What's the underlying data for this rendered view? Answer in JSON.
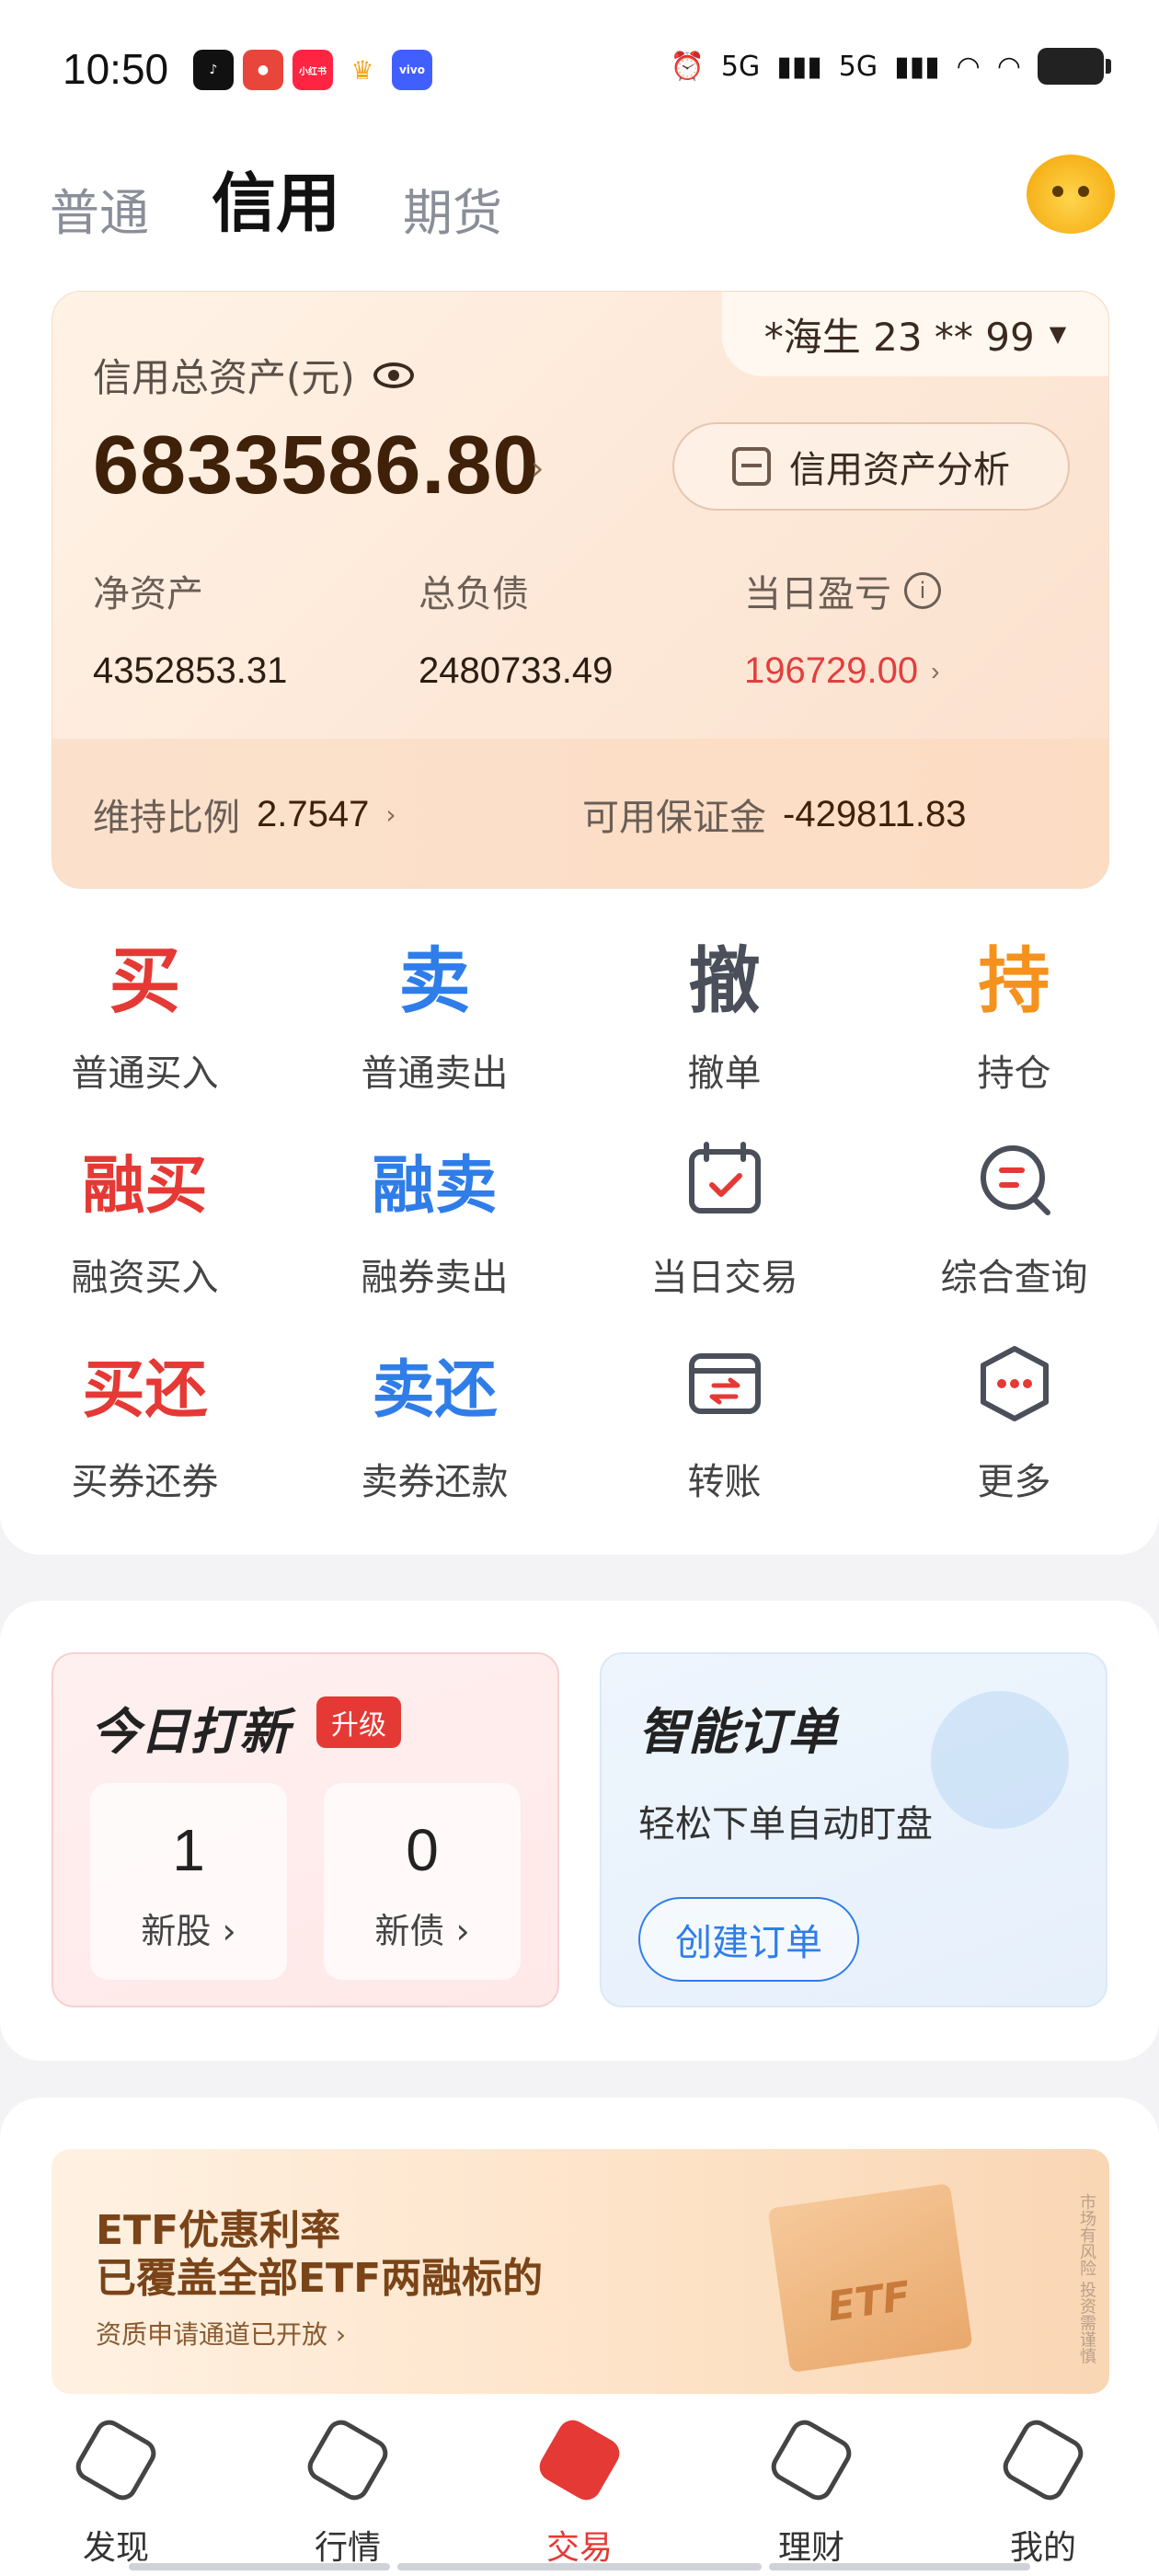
{
  "status_bar": {
    "time": "10:50",
    "app_icons": [
      {
        "name": "tiktok-icon",
        "text": "♪",
        "color": "#111111"
      },
      {
        "name": "weibo-icon",
        "text": "●",
        "color": "#e8463b"
      },
      {
        "name": "xiaohongshu-icon",
        "text": "小红书",
        "color": "#ff2442"
      },
      {
        "name": "crown-app-icon",
        "text": "♛",
        "color": "#f5a623"
      },
      {
        "name": "vivo-icon",
        "text": "vivo",
        "color": "#415fff"
      }
    ],
    "signal_1": "5G",
    "signal_2": "5G"
  },
  "mode_tabs": [
    "普通",
    "信用",
    "期货"
  ],
  "credit": {
    "account": "*海生 23 ** 99",
    "total_label": "信用总资产(元)",
    "total_value": "6833586.80",
    "analysis_btn": "信用资产分析",
    "net_assets_label": "净资产",
    "net_assets_value": "4352853.31",
    "liabilities_label": "总负债",
    "liabilities_value": "2480733.49",
    "daily_pl_label": "当日盈亏",
    "daily_pl_value": "196729.00",
    "maint_ratio_label": "维持比例",
    "maint_ratio_value": "2.7547",
    "margin_label": "可用保证金",
    "margin_value": "-429811.83"
  },
  "trade_grid": [
    {
      "glyph": "买",
      "label": "普通买入",
      "color": "c-red"
    },
    {
      "glyph": "卖",
      "label": "普通卖出",
      "color": "c-blue"
    },
    {
      "glyph": "撤",
      "label": "撤单",
      "color": "c-gray"
    },
    {
      "glyph": "持",
      "label": "持仓",
      "color": "c-orange"
    },
    {
      "glyph": "融买",
      "label": "融资买入",
      "color": "c-red"
    },
    {
      "glyph": "融卖",
      "label": "融券卖出",
      "color": "c-blue"
    },
    {
      "glyph": "",
      "label": "当日交易",
      "icon": "calendar-check-icon"
    },
    {
      "glyph": "",
      "label": "综合查询",
      "icon": "search-query-icon"
    },
    {
      "glyph": "买还",
      "label": "买券还券",
      "color": "c-red"
    },
    {
      "glyph": "卖还",
      "label": "卖券还款",
      "color": "c-blue"
    },
    {
      "glyph": "",
      "label": "转账",
      "icon": "transfer-card-icon"
    },
    {
      "glyph": "",
      "label": "更多",
      "icon": "more-icon"
    }
  ],
  "ipo": {
    "title": "今日打新",
    "badge": "升级",
    "stocks_count": "1",
    "stocks_label": "新股",
    "bonds_count": "0",
    "bonds_label": "新债"
  },
  "smart_order": {
    "title": "智能订单",
    "desc": "轻松下单自动盯盘",
    "button": "创建订单"
  },
  "banner": {
    "line1": "ETF优惠利率",
    "line2": "已覆盖全部ETF两融标的",
    "sub": "资质申请通道已开放",
    "box_label": "ETF",
    "side_text": "市场有风险 投资需谨慎"
  },
  "bottom_nav": [
    {
      "label": "发现",
      "icon": "compass-icon"
    },
    {
      "label": "行情",
      "icon": "trend-icon"
    },
    {
      "label": "交易",
      "icon": "trade-icon",
      "active": true
    },
    {
      "label": "理财",
      "icon": "finance-icon"
    },
    {
      "label": "我的",
      "icon": "profile-icon"
    }
  ],
  "colors": {
    "brand_red": "#e53935",
    "brand_blue": "#2f7de9",
    "accent_orange": "#f5921e",
    "asset_brown": "#3f2109"
  }
}
